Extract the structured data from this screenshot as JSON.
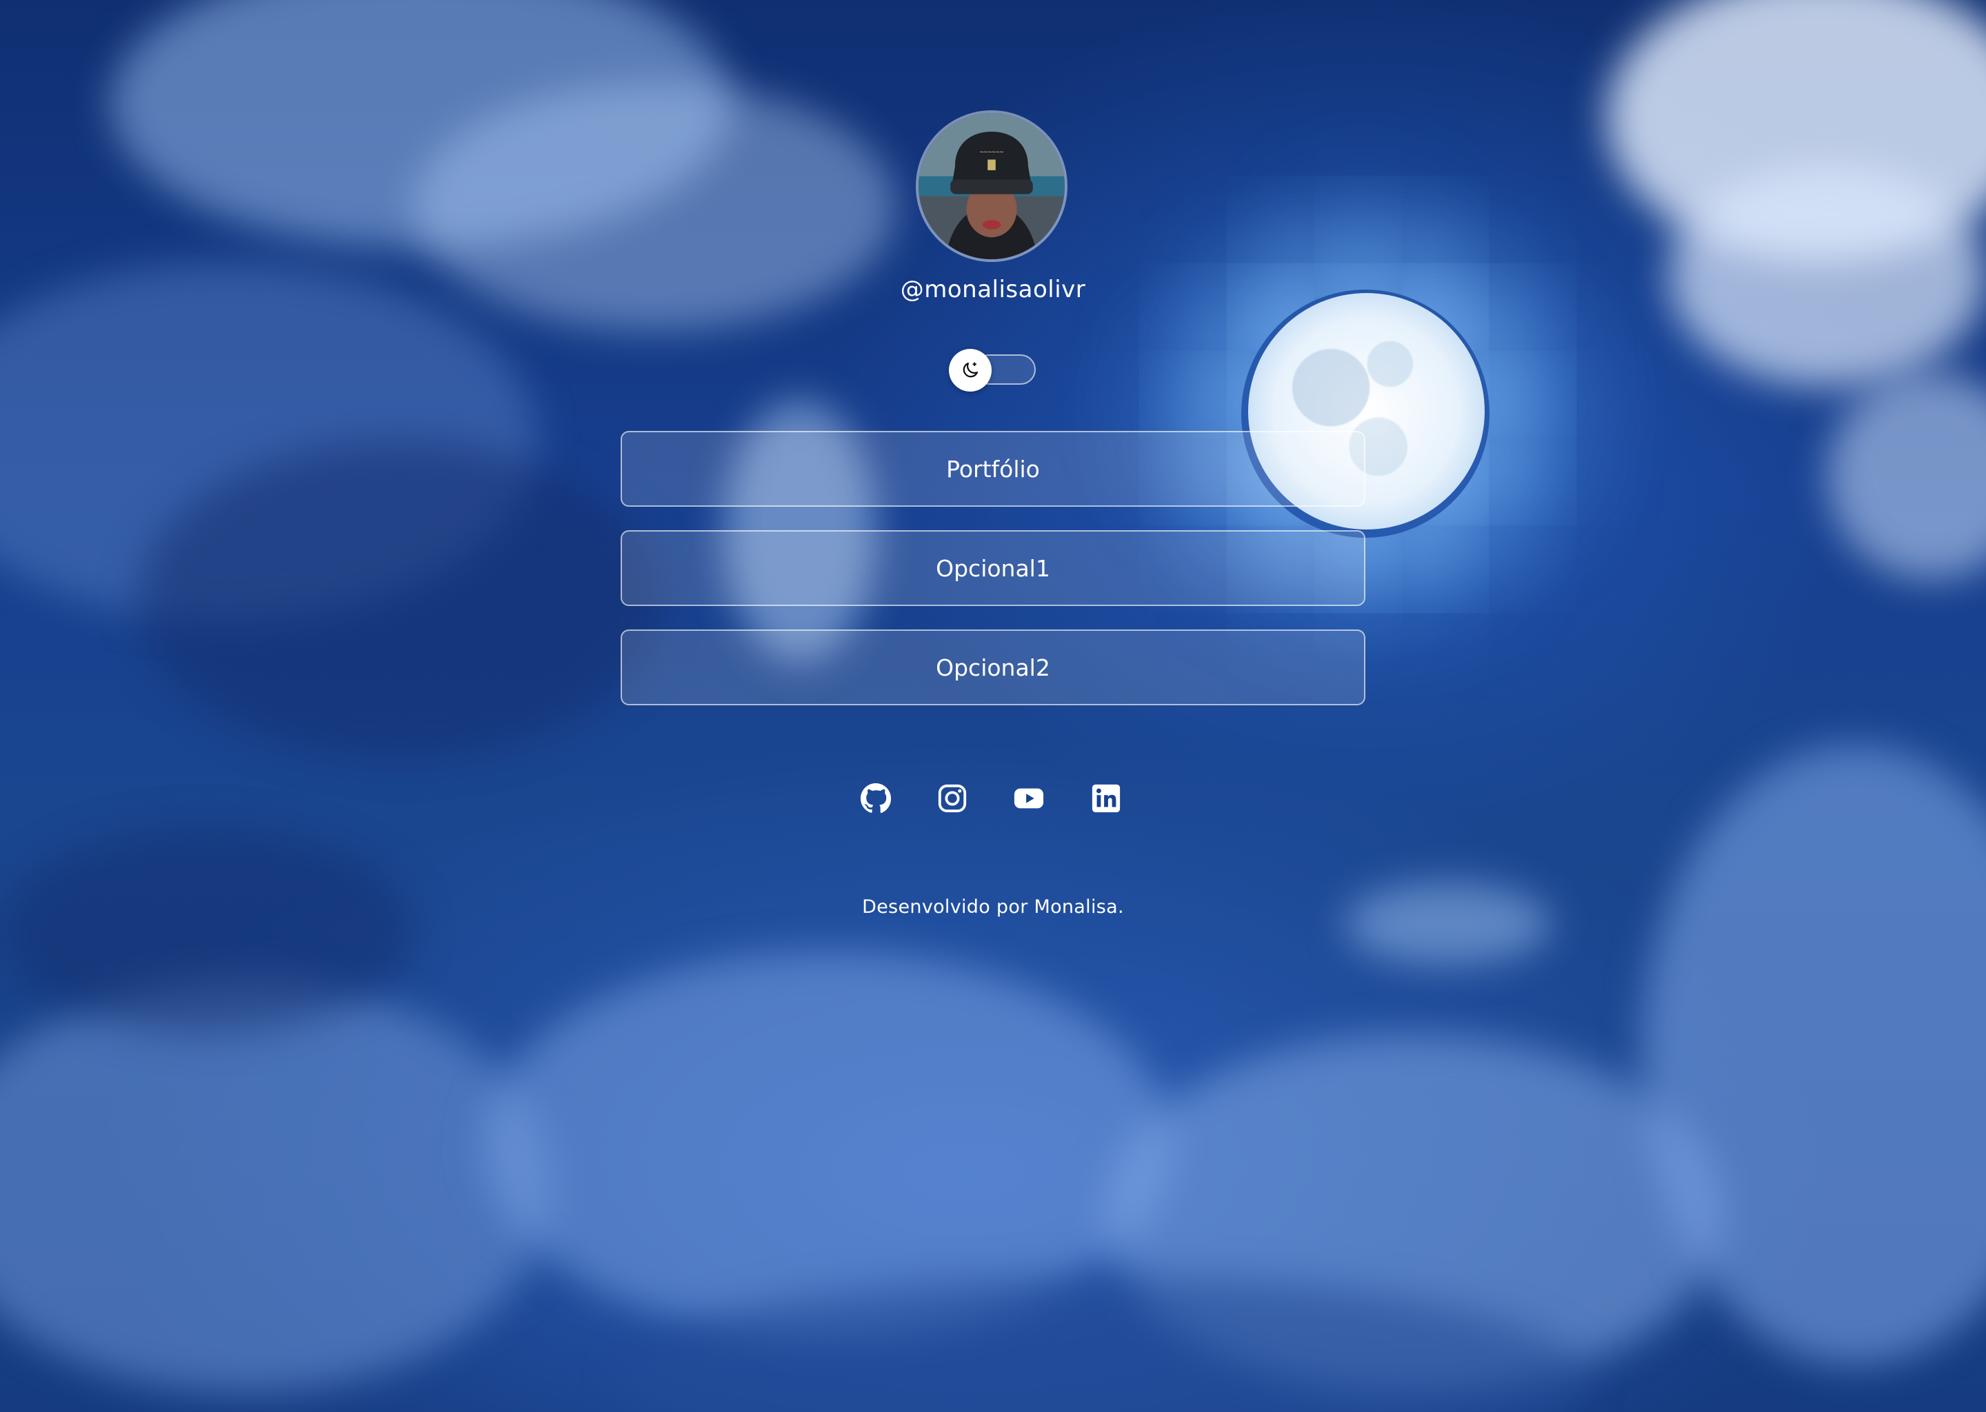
{
  "profile": {
    "username": "@monalisaolivr",
    "avatar_alt": "avatar"
  },
  "theme_toggle": {
    "icon": "moon-icon",
    "state": "dark"
  },
  "links": [
    {
      "label": "Portfólio"
    },
    {
      "label": "Opcional1"
    },
    {
      "label": "Opcional2"
    }
  ],
  "socials": [
    {
      "icon": "github-icon"
    },
    {
      "icon": "instagram-icon"
    },
    {
      "icon": "youtube-icon"
    },
    {
      "icon": "linkedin-icon"
    }
  ],
  "footer": {
    "text": "Desenvolvido por Monalisa."
  },
  "colors": {
    "sky": "#173f8f",
    "button_border": "#ffffff",
    "text": "#ffffff"
  }
}
